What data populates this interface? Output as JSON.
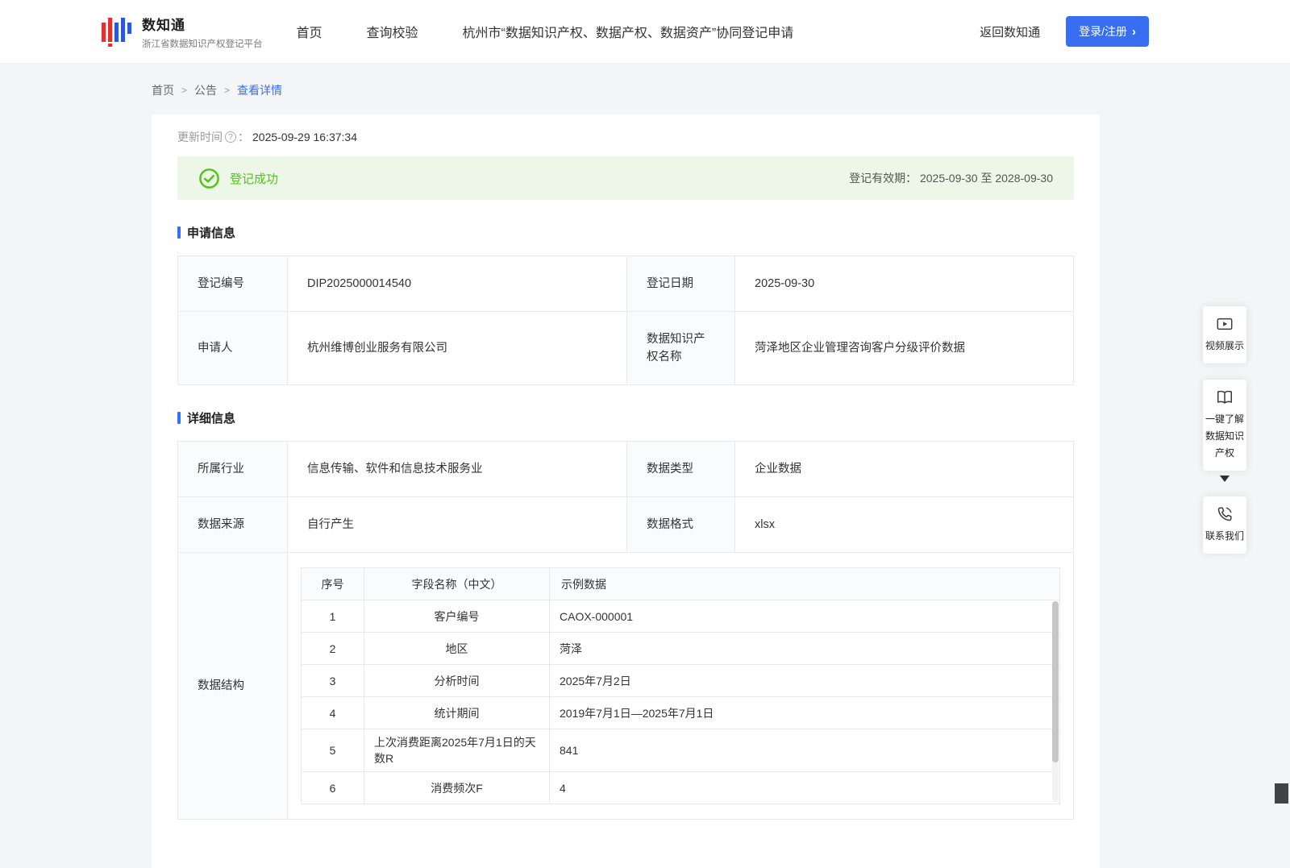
{
  "colors": {
    "accent_blue": "#3370ff",
    "button_blue": "#3a6ef0",
    "success_green": "#52c41a",
    "success_banner_bg": "#edf7e7",
    "page_bg": "#f4f5f7"
  },
  "header": {
    "logo_title": "数知通",
    "logo_subtitle": "浙江省数据知识产权登记平台",
    "nav": [
      "首页",
      "查询校验",
      "杭州市“数据知识产权、数据产权、数据资产”协同登记申请"
    ],
    "back_link": "返回数知通",
    "login_button": "登录/注册",
    "login_chevron": "›"
  },
  "breadcrumb": {
    "items": [
      "首页",
      "公告",
      "查看详情"
    ],
    "separator": ">"
  },
  "page": {
    "update_time_label": "更新时间",
    "help_glyph": "?",
    "colon": "：",
    "update_time": "2025-09-29 16:37:34",
    "banner": {
      "status": "登记成功",
      "validity_label": "登记有效期：",
      "validity_value": "2025-09-30 至 2028-09-30"
    },
    "sections": {
      "application": "申请信息",
      "detail": "详细信息"
    },
    "application_table": {
      "rows": [
        {
          "label1": "登记编号",
          "value1": "DIP2025000014540",
          "label2": "登记日期",
          "value2": "2025-09-30"
        },
        {
          "label1": "申请人",
          "value1": "杭州维博创业服务有限公司",
          "label2": "数据知识产权名称",
          "value2": "菏泽地区企业管理咨询客户分级评价数据"
        }
      ]
    },
    "detail_table": {
      "rows": [
        {
          "label1": "所属行业",
          "value1": "信息传输、软件和信息技术服务业",
          "label2": "数据类型",
          "value2": "企业数据"
        },
        {
          "label1": "数据来源",
          "value1": "自行产生",
          "label2": "数据格式",
          "value2": "xlsx"
        }
      ],
      "structure_label": "数据结构",
      "structure_table": {
        "headers": [
          "序号",
          "字段名称（中文）",
          "示例数据"
        ],
        "rows": [
          [
            "1",
            "客户编号",
            "CAOX-000001"
          ],
          [
            "2",
            "地区",
            "菏泽"
          ],
          [
            "3",
            "分析时间",
            "2025年7月2日"
          ],
          [
            "4",
            "统计期间",
            "2019年7月1日—2025年7月1日"
          ],
          [
            "5",
            "上次消费距离2025年7月1日的天数R",
            "841"
          ],
          [
            "6",
            "消费频次F",
            "4"
          ]
        ]
      }
    }
  },
  "floating_panel": {
    "items": [
      "视频展示",
      "一键了解数据知识产权",
      "联系我们"
    ]
  }
}
